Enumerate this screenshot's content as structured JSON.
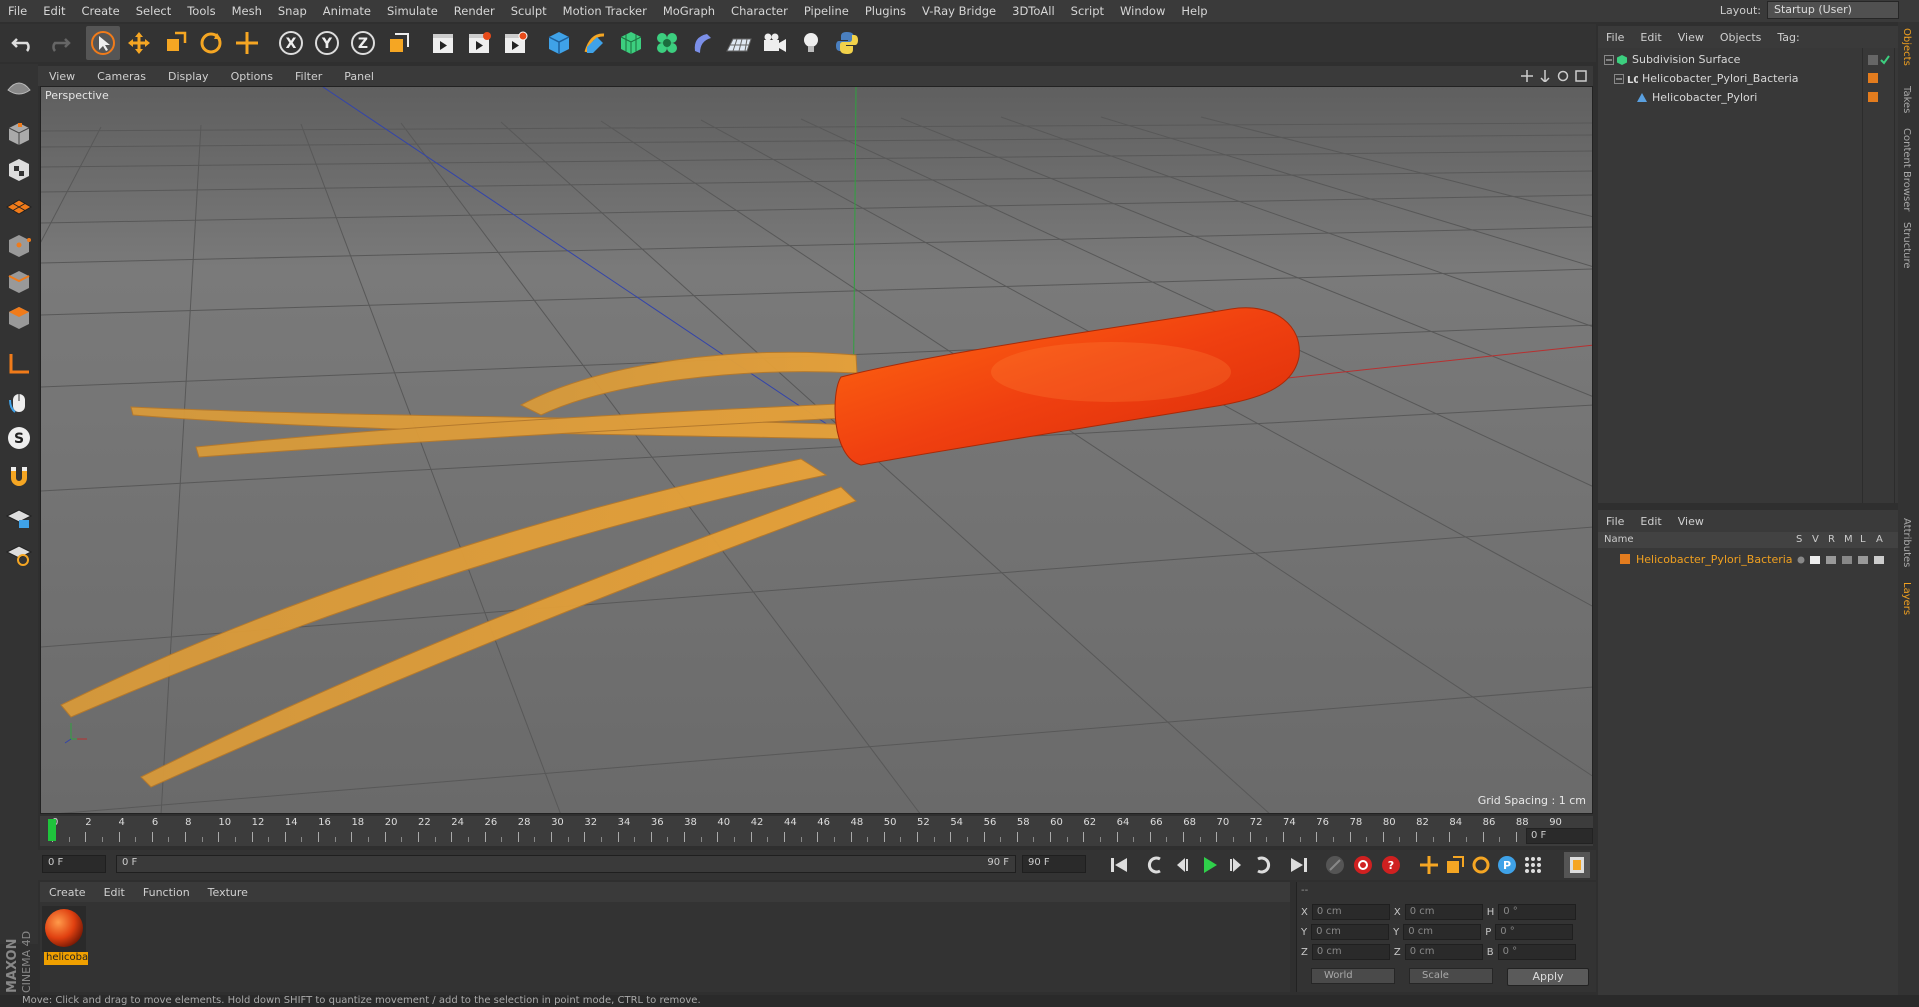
{
  "menu": [
    "File",
    "Edit",
    "Create",
    "Select",
    "Tools",
    "Mesh",
    "Snap",
    "Animate",
    "Simulate",
    "Render",
    "Sculpt",
    "Motion Tracker",
    "MoGraph",
    "Character",
    "Pipeline",
    "Plugins",
    "V-Ray Bridge",
    "3DToAll",
    "Script",
    "Window",
    "Help"
  ],
  "layout": {
    "label": "Layout:",
    "value": "Startup (User)"
  },
  "viewport": {
    "menu": [
      "View",
      "Cameras",
      "Display",
      "Options",
      "Filter",
      "Panel"
    ],
    "label": "Perspective",
    "grid_spacing": "Grid Spacing : 1 cm"
  },
  "timeline": {
    "ticks": [
      "0",
      "2",
      "4",
      "6",
      "8",
      "10",
      "12",
      "14",
      "16",
      "18",
      "20",
      "22",
      "24",
      "26",
      "28",
      "30",
      "32",
      "34",
      "36",
      "38",
      "40",
      "42",
      "44",
      "46",
      "48",
      "50",
      "52",
      "54",
      "56",
      "58",
      "60",
      "62",
      "64",
      "66",
      "68",
      "70",
      "72",
      "74",
      "76",
      "78",
      "80",
      "82",
      "84",
      "86",
      "88",
      "90"
    ],
    "current_frame": "0 F",
    "start_field": "0 F",
    "slider_start": "0 F",
    "slider_end": "90 F",
    "end_field": "90 F"
  },
  "materials": {
    "menu": [
      "Create",
      "Edit",
      "Function",
      "Texture"
    ],
    "items": [
      {
        "name": "helicoba"
      }
    ]
  },
  "coordinates": {
    "header": "--",
    "rows": [
      {
        "a_label": "X",
        "a_value": "0 cm",
        "b_label": "X",
        "b_value": "0 cm",
        "c_label": "H",
        "c_value": "0 °"
      },
      {
        "a_label": "Y",
        "a_value": "0 cm",
        "b_label": "Y",
        "b_value": "0 cm",
        "c_label": "P",
        "c_value": "0 °"
      },
      {
        "a_label": "Z",
        "a_value": "0 cm",
        "b_label": "Z",
        "b_value": "0 cm",
        "c_label": "B",
        "c_value": "0 °"
      }
    ],
    "mode1": "World",
    "mode2": "Scale",
    "apply": "Apply"
  },
  "objects": {
    "menu": [
      "File",
      "Edit",
      "View",
      "Objects",
      "Tag:"
    ],
    "items": [
      {
        "name": "Subdivision Surface"
      },
      {
        "name": "Helicobacter_Pylori_Bacteria"
      },
      {
        "name": "Helicobacter_Pylori"
      }
    ]
  },
  "layers": {
    "menu": [
      "File",
      "Edit",
      "View"
    ],
    "columns": {
      "name": "Name",
      "s": "S",
      "v": "V",
      "r": "R",
      "m": "M",
      "l": "L",
      "a": "A"
    },
    "items": [
      {
        "name": "Helicobacter_Pylori_Bacteria"
      }
    ]
  },
  "side_tabs": [
    "Objects",
    "Takes",
    "Content Browser",
    "Structure",
    "Attributes",
    "Layers"
  ],
  "status": "Move: Click and drag to move elements. Hold down SHIFT to quantize movement / add to the selection in point mode, CTRL to remove.",
  "maxon": {
    "line1": "MAXON",
    "line2": "CINEMA 4D"
  },
  "colors": {
    "accent_orange": "#f07b1a",
    "layer_orange": "#e37c1e",
    "bacteria_red": "#f04010",
    "flagella": "#d89a3a"
  }
}
